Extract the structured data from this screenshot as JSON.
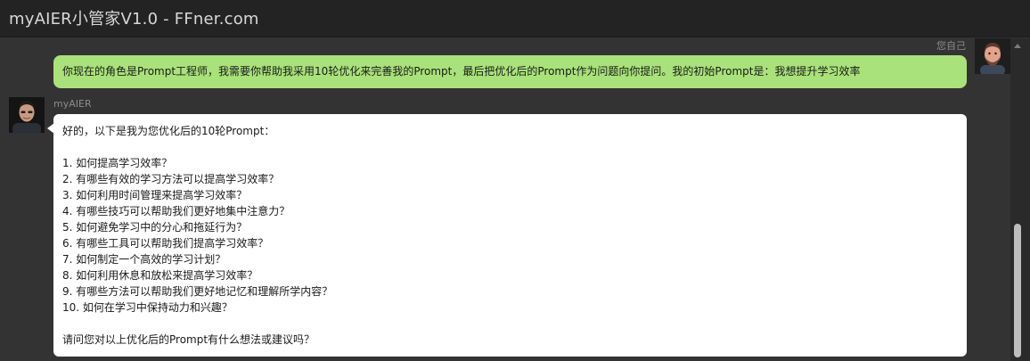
{
  "window": {
    "title": "myAIER小管家V1.0 - FFner.com"
  },
  "colors": {
    "user_bubble": "#a9e27a",
    "bot_bubble": "#ffffff",
    "background": "#333333",
    "titlebar": "#232323"
  },
  "user_message": {
    "sender": "您自己",
    "avatar_icon": "user-avatar-icon",
    "text": "你现在的角色是Prompt工程师，我需要你帮助我采用10轮优化来完善我的Prompt，最后把优化后的Prompt作为问题向你提问。我的初始Prompt是：我想提升学习效率"
  },
  "bot_message": {
    "sender": "myAIER",
    "avatar_icon": "bot-avatar-icon",
    "intro": "好的，以下是我为您优化后的10轮Prompt：",
    "items": [
      "1. 如何提高学习效率？",
      "2. 有哪些有效的学习方法可以提高学习效率？",
      "3. 如何利用时间管理来提高学习效率？",
      "4. 有哪些技巧可以帮助我们更好地集中注意力？",
      "5. 如何避免学习中的分心和拖延行为？",
      "6. 有哪些工具可以帮助我们提高学习效率？",
      "7. 如何制定一个高效的学习计划？",
      "8. 如何利用休息和放松来提高学习效率？",
      "9. 有哪些方法可以帮助我们更好地记忆和理解所学内容？",
      "10. 如何在学习中保持动力和兴趣？"
    ],
    "outro": "请问您对以上优化后的Prompt有什么想法或建议吗？"
  }
}
